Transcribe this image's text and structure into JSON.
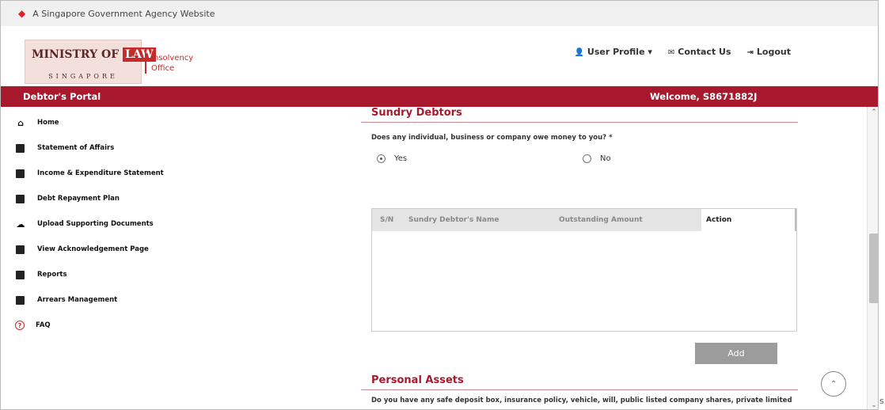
{
  "gov_bar": {
    "text": "A Singapore Government Agency Website"
  },
  "header": {
    "logo_text_1": "MINISTRY OF",
    "logo_text_2": "LAW",
    "logo_text_3": "SINGAPORE",
    "org_line_1": "Insolvency",
    "org_line_2": "Office",
    "nav": {
      "user_profile": "User Profile ▾",
      "contact_us": "Contact Us",
      "logout": "Logout"
    }
  },
  "portal_bar": {
    "title": "Debtor's Portal",
    "welcome": "Welcome, S8671882J"
  },
  "sidebar": {
    "items": [
      {
        "label": "Home",
        "icon": "home-icon"
      },
      {
        "label": "Statement of Affairs",
        "icon": "document-icon"
      },
      {
        "label": "Income & Expenditure Statement",
        "icon": "calculator-icon"
      },
      {
        "label": "Debt Repayment Plan",
        "icon": "plan-icon"
      },
      {
        "label": "Upload Supporting Documents",
        "icon": "cloud-upload-icon"
      },
      {
        "label": "View Acknowledgement Page",
        "icon": "acknowledgement-icon"
      },
      {
        "label": "Reports",
        "icon": "report-icon"
      },
      {
        "label": "Arrears Management",
        "icon": "arrears-icon"
      },
      {
        "label": "FAQ",
        "icon": "question-icon"
      }
    ]
  },
  "main": {
    "sundry": {
      "title": "Sundry Debtors",
      "question": "Does any individual, business or company owe money to you? *",
      "yes_label": "Yes",
      "no_label": "No",
      "selected": "Yes",
      "table": {
        "columns": [
          "S/N",
          "Sundry Debtor's Name",
          "Outstanding Amount",
          "Action"
        ],
        "rows": []
      },
      "add_label": "Add"
    },
    "assets": {
      "title": "Personal Assets",
      "question": "Do you have any safe deposit box, insurance policy, vehicle, will, public listed company shares, private limited"
    }
  },
  "edge_char": "s",
  "colors": {
    "brand": "#a8192e",
    "button_disabled": "#9c9c9c"
  }
}
